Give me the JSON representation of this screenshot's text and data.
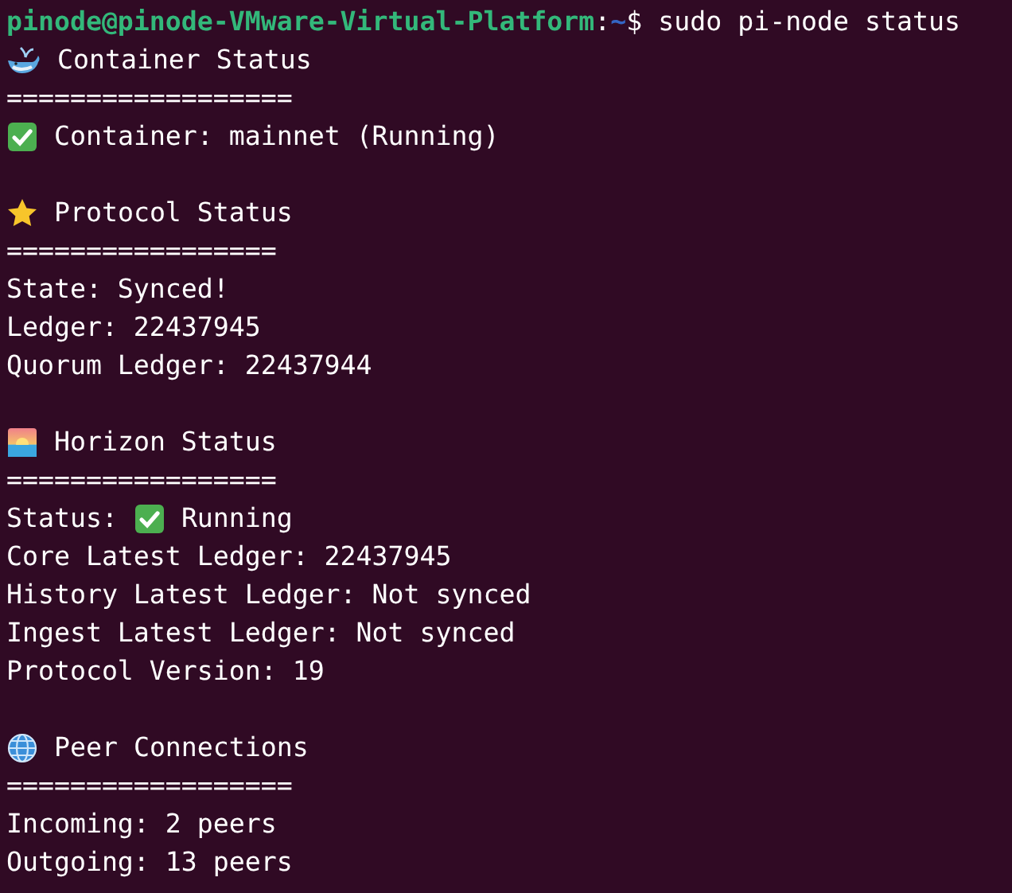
{
  "prompt": {
    "user_host": "pinode@pinode-VMware-Virtual-Platform",
    "separator": ":",
    "path": "~",
    "symbol": "$",
    "command": "sudo pi-node status"
  },
  "sections": [
    {
      "title": "Container Status",
      "rule": "==================",
      "lines": [
        {
          "kind": "check",
          "text": "Container: mainnet (Running)"
        }
      ]
    },
    {
      "title": "Protocol Status",
      "rule": "=================",
      "lines": [
        {
          "kind": "plain",
          "text": "State: Synced!"
        },
        {
          "kind": "plain",
          "text": "Ledger: 22437945"
        },
        {
          "kind": "plain",
          "text": "Quorum Ledger: 22437944"
        }
      ]
    },
    {
      "title": "Horizon Status",
      "rule": "=================",
      "lines": [
        {
          "kind": "label_check",
          "label": "Status:",
          "text": "Running"
        },
        {
          "kind": "plain",
          "text": "Core Latest Ledger: 22437945"
        },
        {
          "kind": "plain",
          "text": "History Latest Ledger: Not synced"
        },
        {
          "kind": "plain",
          "text": "Ingest Latest Ledger: Not synced"
        },
        {
          "kind": "plain",
          "text": "Protocol Version: 19"
        }
      ]
    },
    {
      "title": "Peer Connections",
      "rule": "==================",
      "lines": [
        {
          "kind": "plain",
          "text": "Incoming: 2 peers"
        },
        {
          "kind": "plain",
          "text": "Outgoing: 13 peers"
        }
      ]
    }
  ]
}
